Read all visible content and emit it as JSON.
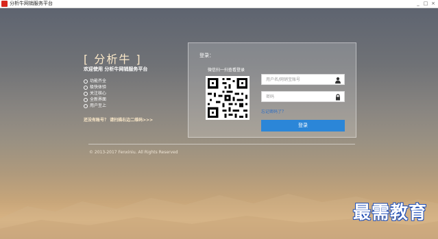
{
  "window": {
    "title": "分析牛网销服务平台",
    "controls": [
      "_",
      "□",
      "×"
    ]
  },
  "brand": {
    "name": "[ 分析牛 ]",
    "welcome": "欢迎使用 分析牛网销服务平台"
  },
  "features": [
    "功能齐全",
    "极快体验",
    "关注核心",
    "全新界面",
    "用户至上"
  ],
  "no_account_text": "还没有账号？ 请扫描右边二维码>>>",
  "login": {
    "heading": "登录：",
    "qr_label": "微信扫一扫查看登录",
    "username_placeholder": "用户名/网销宝账号",
    "password_placeholder": "密码",
    "forgot": "忘记密码了？",
    "button": "登录"
  },
  "footer": {
    "copyright": "© 2013-2017 Fenxiniu. All Rights Reserved"
  },
  "watermark": "最需教育",
  "colors": {
    "login_button": "#2b86d8",
    "brand_text": "#fbe8c8",
    "link": "#2a6cc4"
  },
  "icons": {
    "username_field": "user-icon",
    "password_field": "lock-icon"
  }
}
